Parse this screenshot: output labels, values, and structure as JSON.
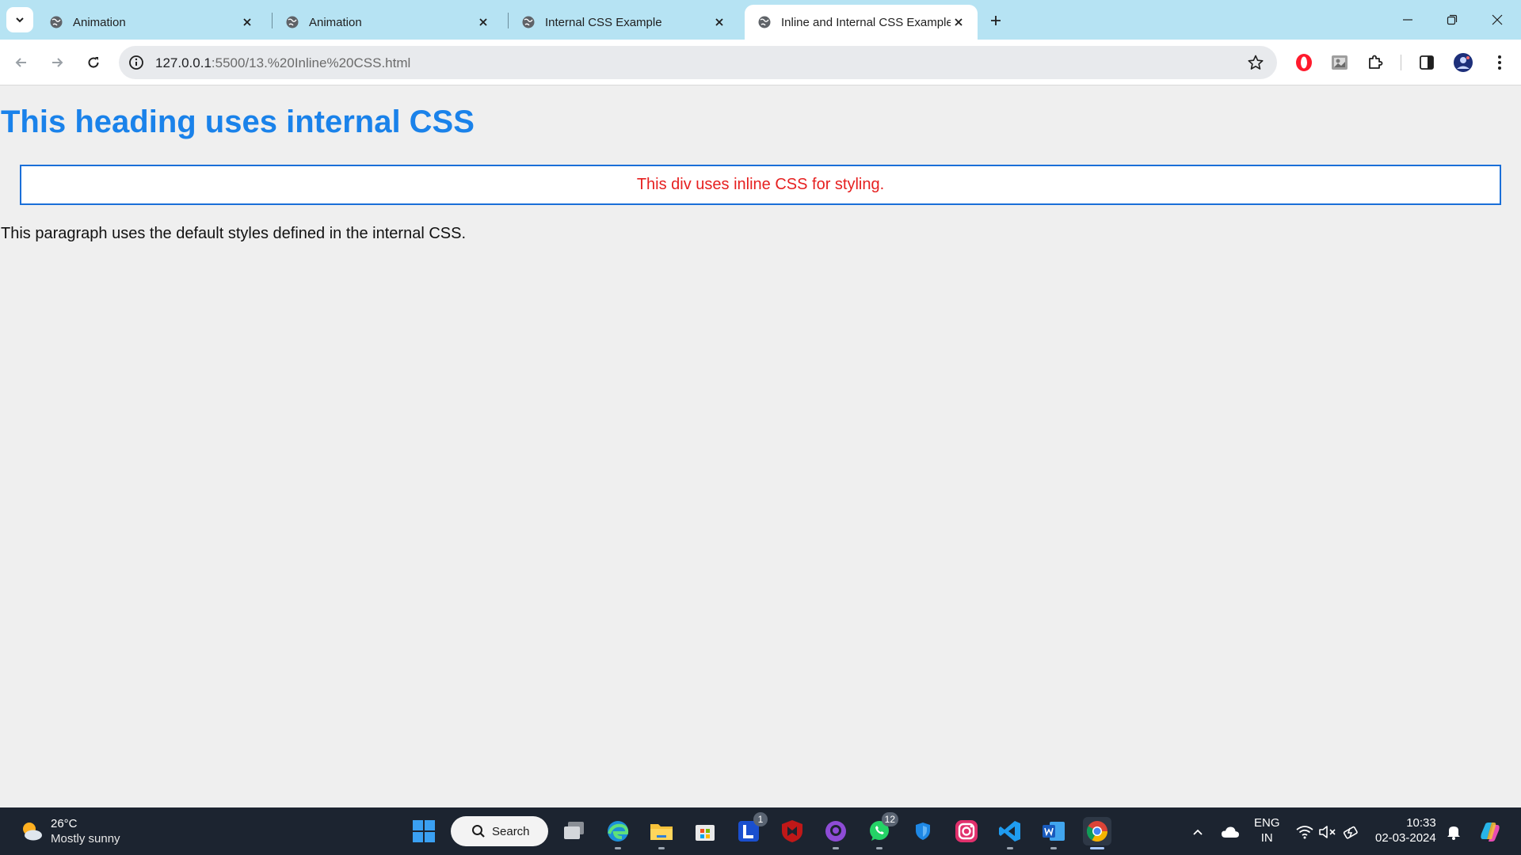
{
  "browser": {
    "tabs": [
      {
        "title": "Animation",
        "active": false
      },
      {
        "title": "Animation",
        "active": false
      },
      {
        "title": "Internal CSS Example",
        "active": false
      },
      {
        "title": "Inline and Internal CSS Example",
        "active": true
      }
    ],
    "address": {
      "host": "127.0.0.1",
      "path": ":5500/13.%20Inline%20CSS.html"
    }
  },
  "page": {
    "heading": "This heading uses internal CSS",
    "inline_div": "This div uses inline CSS for styling.",
    "paragraph": "This paragraph uses the default styles defined in the internal CSS.",
    "colors": {
      "heading": "#1a82ea",
      "div_text": "#e62020",
      "div_border": "#1a6fd8"
    }
  },
  "taskbar": {
    "weather": {
      "temp": "26°C",
      "condition": "Mostly sunny"
    },
    "search_label": "Search",
    "badges": {
      "lightshot": "1",
      "whatsapp": "12"
    },
    "language": {
      "line1": "ENG",
      "line2": "IN"
    },
    "clock": {
      "time": "10:33",
      "date": "02-03-2024"
    }
  }
}
